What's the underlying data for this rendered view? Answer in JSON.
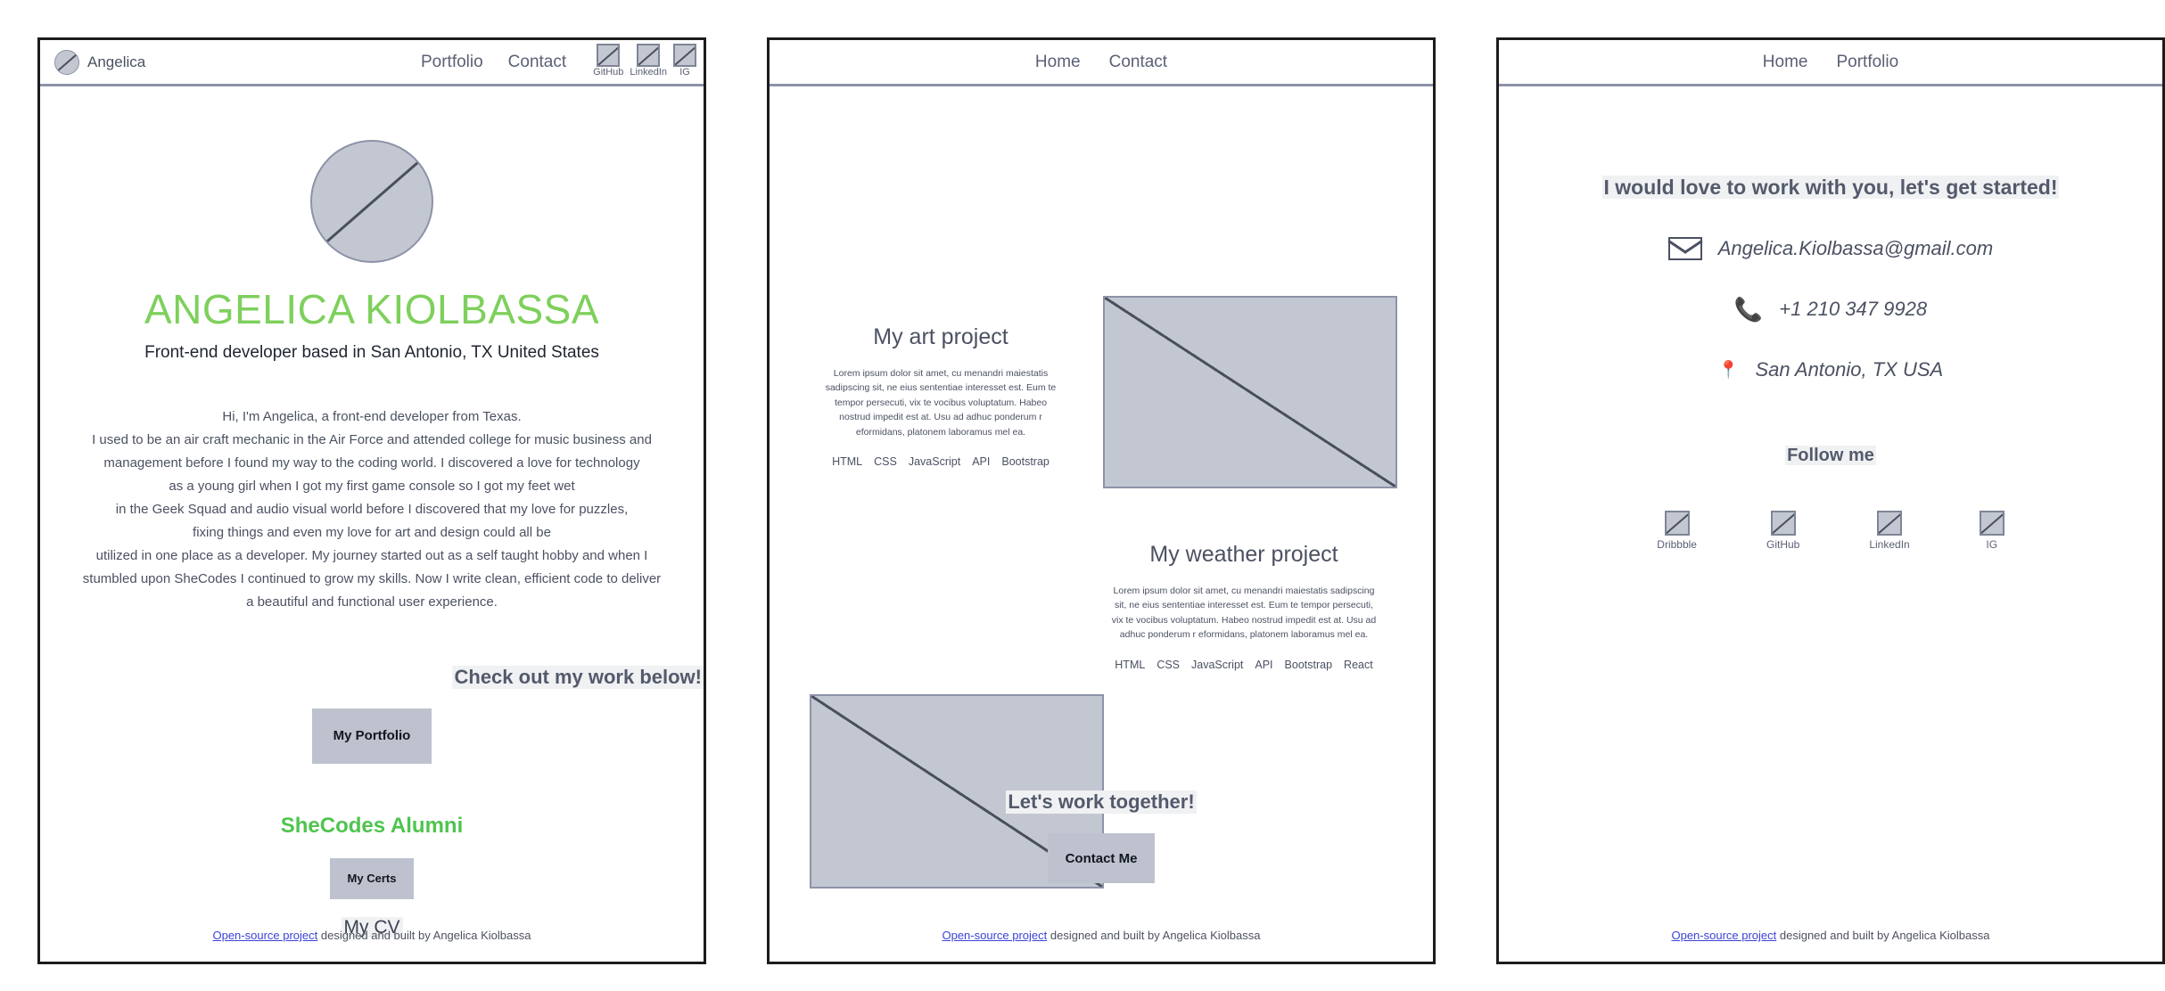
{
  "colors": {
    "brand_green": "#7ed05c",
    "alumni_green": "#4fc44f",
    "heading_slate": "#535a6b",
    "body_slate": "#4b5162",
    "button_gray": "#bdc2ce",
    "link_blue": "#3b43d8",
    "placeholder_fill": "#c3c7d1",
    "placeholder_border": "#8c93a8"
  },
  "footer": {
    "link_label": "Open-source project",
    "rest": " designed and built by Angelica Kiolbassa"
  },
  "home": {
    "navbar": {
      "brand_name": "Angelica",
      "brand_avatar_icon": "broken-image-circle-icon",
      "links": [
        {
          "label": "Portfolio"
        },
        {
          "label": "Contact"
        }
      ],
      "socials": [
        {
          "label": "GitHub",
          "icon": "broken-image-icon"
        },
        {
          "label": "LinkedIn",
          "icon": "broken-image-icon"
        },
        {
          "label": "IG",
          "icon": "broken-image-icon"
        }
      ]
    },
    "hero": {
      "avatar_icon": "broken-image-circle-icon",
      "name": "ANGELICA KIOLBASSA",
      "tagline": "Front-end developer based in San Antonio, TX United States"
    },
    "bio": "Hi, I'm Angelica,  a front-end developer from Texas.\nI used to be an air craft mechanic in the Air Force and attended college for music business and\nmanagement before I found my way to the coding world. I discovered a love for technology\nas a young girl when I got my first game console so I got my feet wet\nin the Geek Squad and audio visual world before I discovered that my love for puzzles,\nfixing things and even my love for art  and design could all be\nutilized in one place as a developer. My journey started out as a self taught hobby and when I\nstumbled upon SheCodes I continued to grow my skills. Now I write clean, efficient code to deliver\na beautiful and functional user experience.",
    "cta_heading": "Check out my work below!",
    "portfolio_button": "My Portfolio",
    "alumni_heading": "SheCodes Alumni",
    "certs_button": "My Certs",
    "cv_link": "My CV"
  },
  "work": {
    "navbar": {
      "links": [
        {
          "label": "Home"
        },
        {
          "label": "Contact"
        }
      ]
    },
    "projects": [
      {
        "title": "My art project",
        "body": "Lorem ipsum dolor sit amet, cu menandri maiestatis sadipscing sit, ne eius sententiae interesset est. Eum te tempor persecuti, vix te vocibus voluptatum. Habeo nostrud impedit est at. Usu ad adhuc ponderum r eformidans, platonem laboramus mel ea.",
        "tags": [
          "HTML",
          "CSS",
          "JavaScript",
          "API",
          "Bootstrap"
        ],
        "image_icon": "broken-image-icon"
      },
      {
        "title": "My weather project",
        "body": "Lorem ipsum dolor sit amet, cu menandri maiestatis sadipscing sit, ne eius sententiae interesset est. Eum te tempor persecuti, vix te vocibus voluptatum. Habeo nostrud impedit est at. Usu ad adhuc ponderum r eformidans, platonem laboramus mel ea.",
        "tags": [
          "HTML",
          "CSS",
          "JavaScript",
          "API",
          "Bootstrap",
          "React"
        ],
        "image_icon": "broken-image-icon"
      }
    ],
    "cta_heading": "Let's work together!",
    "contact_button": "Contact Me"
  },
  "contact": {
    "navbar": {
      "links": [
        {
          "label": "Home"
        },
        {
          "label": "Portfolio"
        }
      ]
    },
    "heading": "I would love to work with you, let's get started!",
    "details": [
      {
        "icon": "envelope-icon",
        "value": "Angelica.Kiolbassa@gmail.com"
      },
      {
        "icon": "phone-icon",
        "value": "+1 210 347 9928"
      },
      {
        "icon": "map-pin-icon",
        "value": "San Antonio, TX USA"
      }
    ],
    "phone_glyph": "📞",
    "pin_glyph": "📍",
    "follow_heading": "Follow me",
    "socials": [
      {
        "label": "Dribbble",
        "icon": "broken-image-icon"
      },
      {
        "label": "GitHub",
        "icon": "broken-image-icon"
      },
      {
        "label": "LinkedIn",
        "icon": "broken-image-icon"
      },
      {
        "label": "IG",
        "icon": "broken-image-icon"
      }
    ]
  }
}
